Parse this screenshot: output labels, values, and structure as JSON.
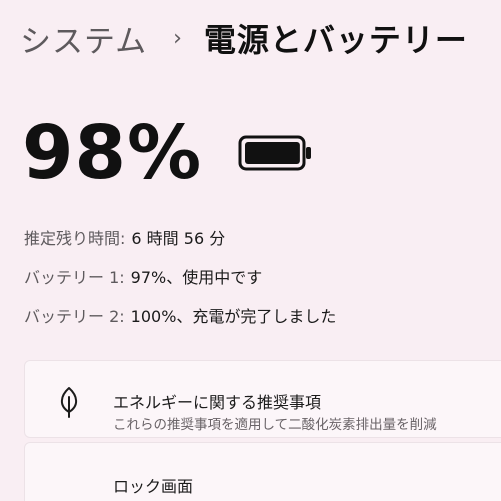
{
  "breadcrumb": {
    "parent": "システム",
    "separator": "›",
    "current": "電源とバッテリー"
  },
  "battery": {
    "percent_text": "98%",
    "charge_level": 0.98,
    "icon": "battery-icon"
  },
  "info": {
    "remaining_label": "推定残り時間:",
    "remaining_value": "6 時間 56 分",
    "battery1_label": "バッテリー 1:",
    "battery1_value": "97%、使用中です",
    "battery2_label": "バッテリー 2:",
    "battery2_value": "100%、充電が完了しました"
  },
  "cards": {
    "energy_recommendations": {
      "icon": "leaf-icon",
      "title": "エネルギーに関する推奨事項",
      "subtitle": "これらの推奨事項を適用して二酸化炭素排出量を削減"
    },
    "next_partial": {
      "title": "ロック画面"
    }
  },
  "colors": {
    "background": "#f9eef3",
    "card": "#fcf6f9",
    "text": "#1b1b1b",
    "secondary_text": "#5e5a5d"
  }
}
